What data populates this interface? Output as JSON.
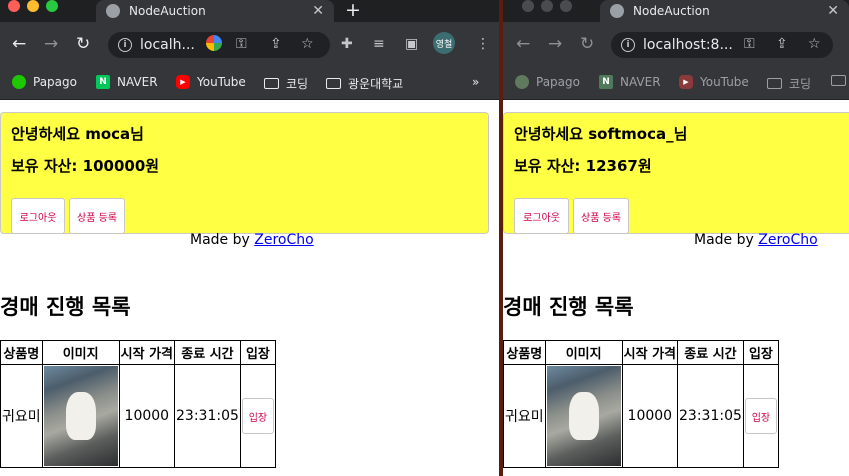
{
  "browser": {
    "tab_title": "NodeAuction",
    "new_tab_glyph": "+",
    "profile_label": "영철",
    "bookmarks": [
      {
        "label": "Papago",
        "icon": "papago-icon"
      },
      {
        "label": "NAVER",
        "icon": "naver-icon",
        "badge": "N"
      },
      {
        "label": "YouTube",
        "icon": "youtube-icon"
      },
      {
        "label": "코딩",
        "icon": "folder-icon"
      },
      {
        "label": "광운대학교",
        "icon": "folder-icon"
      }
    ],
    "bookmarks_overflow": "»",
    "urls": {
      "left": "localh...",
      "right": "localhost:8..."
    }
  },
  "windows": [
    {
      "greeting": "안녕하세요 moca님",
      "assets": "보유 자산: 100000원",
      "logout_label": "로그아웃",
      "register_label": "상품 등록",
      "made_by_prefix": "Made by ",
      "made_by_link": "ZeroCho",
      "section_title": "경매 진행 목록",
      "table": {
        "headers": [
          "상품명",
          "이미지",
          "시작 가격",
          "종료 시간",
          "입장"
        ],
        "rows": [
          {
            "name": "귀요미",
            "start_price": "10000",
            "end_time": "23:31:05",
            "enter_label": "입장"
          }
        ]
      }
    },
    {
      "greeting": "안녕하세요 softmoca_님",
      "assets": "보유 자산: 12367원",
      "logout_label": "로그아웃",
      "register_label": "상품 등록",
      "made_by_prefix": "Made by ",
      "made_by_link": "ZeroCho",
      "section_title": "경매 진행 목록",
      "table": {
        "headers": [
          "상품명",
          "이미지",
          "시작 가격",
          "종료 시간",
          "입장"
        ],
        "rows": [
          {
            "name": "귀요미",
            "start_price": "10000",
            "end_time": "23:31:05",
            "enter_label": "입장"
          }
        ]
      }
    }
  ],
  "colors": {
    "panel_yellow": "#ffff44",
    "button_text": "#d00048",
    "link": "#0000ee",
    "chrome_dark": "#35363a"
  }
}
